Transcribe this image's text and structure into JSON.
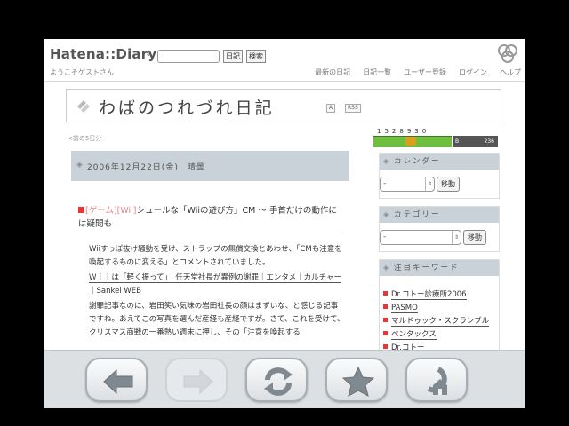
{
  "header": {
    "logo": "Hatena::Diary",
    "search_placeholder": "",
    "diary_button": "日記",
    "search_button": "検索",
    "welcome": "ようこそゲストさん",
    "nav": [
      "最新の日記",
      "日記一覧",
      "ユーザー登録",
      "ログイン",
      "ヘルプ"
    ]
  },
  "diary": {
    "title": "わばのつれづれ日記",
    "badge_a": "A",
    "badge_rss": "RSS",
    "prev_link": "<前の5日分"
  },
  "entry": {
    "date": "2006年12月22日(金)　晴曇",
    "categories": [
      "[ゲーム]",
      "[Wii]"
    ],
    "title": "シュールな「Wiiの遊び方」CM ～ 手首だけの動作には疑問も",
    "para1": "Wiiすっぽ抜け騒動を受け、ストラップの無償交換とあわせ、「CMも注意を喚起するものに変える」とコメントされていました。",
    "para2": "Ｗｉｉは「軽く振って」　任天堂社長が異例の謝罪｜エンタメ｜カルチャー｜Sankei WEB",
    "para3": "謝罪記事なのに、岩田笑い気味の岩田社長の顔はまずいな、と感じる記事ですね。あえてこの写真を選んだ産経も産経ですが。さて、これを受けて、クリスマス商戦の一番熱い週末に押し、その「注意を喚起する"
  },
  "sidebar": {
    "counter": "1528930",
    "counter_b_label": "B",
    "counter_b_value": "236",
    "calendar_title": "カレンダー",
    "calendar_select": "-",
    "calendar_go": "移動",
    "category_title": "カテゴリー",
    "category_select": "-",
    "category_go": "移動",
    "keywords_title": "注目キーワード",
    "keywords": [
      "Dr.コトー診療所2006",
      "PASMO",
      "マルドゥック・スクランブル",
      "ペンタックス",
      "Dr.コトー"
    ]
  },
  "colors": {
    "section_header": "#c9d2d8",
    "accent_red": "#ee3333",
    "counter_green": "#6fbe3f",
    "toolbar_bg": "#dde0e3"
  },
  "toolbar": {
    "buttons": [
      "back-arrow-icon",
      "forward-arrow-icon",
      "reload-icon",
      "favorites-star-icon",
      "home-icon"
    ]
  }
}
